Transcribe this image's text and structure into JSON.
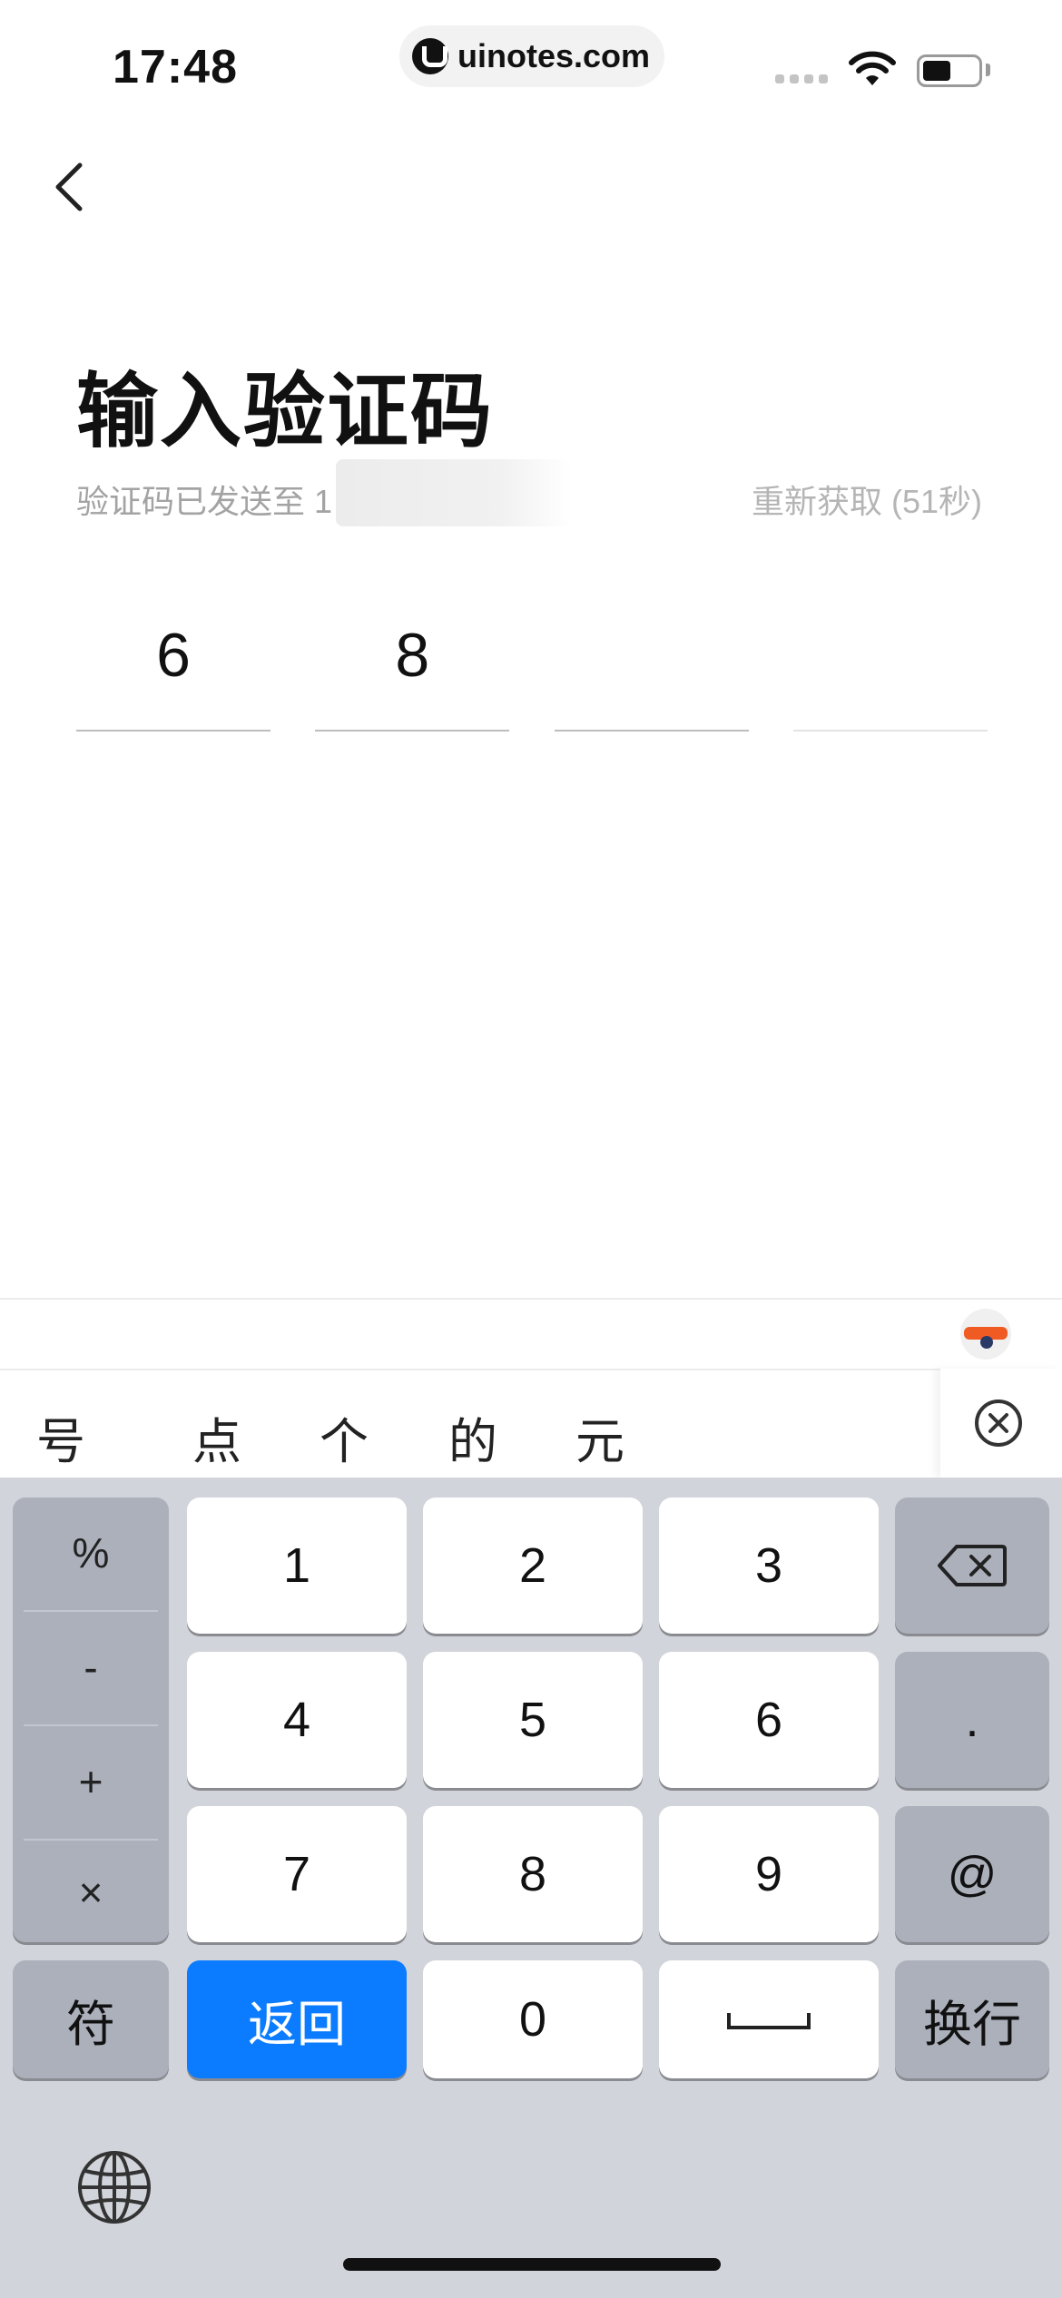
{
  "status_bar": {
    "time": "17:48",
    "watermark": "uinotes.com",
    "battery_percent": 55
  },
  "page": {
    "title": "输入验证码",
    "sent_text": "验证码已发送至 1",
    "resend": "重新获取 (51秒)"
  },
  "code": {
    "digits": [
      "6",
      "8",
      "",
      ""
    ]
  },
  "candidates": [
    "号",
    "点",
    "个",
    "的",
    "元"
  ],
  "keyboard": {
    "symbols": [
      "%",
      "-",
      "+",
      "×"
    ],
    "digits": [
      "1",
      "2",
      "3",
      "4",
      "5",
      "6",
      "7",
      "8",
      "9",
      "0"
    ],
    "dot": ".",
    "at": "@",
    "fu": "符",
    "return": "返回",
    "newline": "换行"
  },
  "colors": {
    "accent": "#0b7bff",
    "keyboard_bg": "#d1d4da",
    "key_gray": "#abb0bb"
  },
  "icons": [
    "back-chevron-icon",
    "wifi-icon",
    "battery-icon",
    "delete-icon",
    "clear-circle-icon",
    "space-icon",
    "globe-icon"
  ]
}
